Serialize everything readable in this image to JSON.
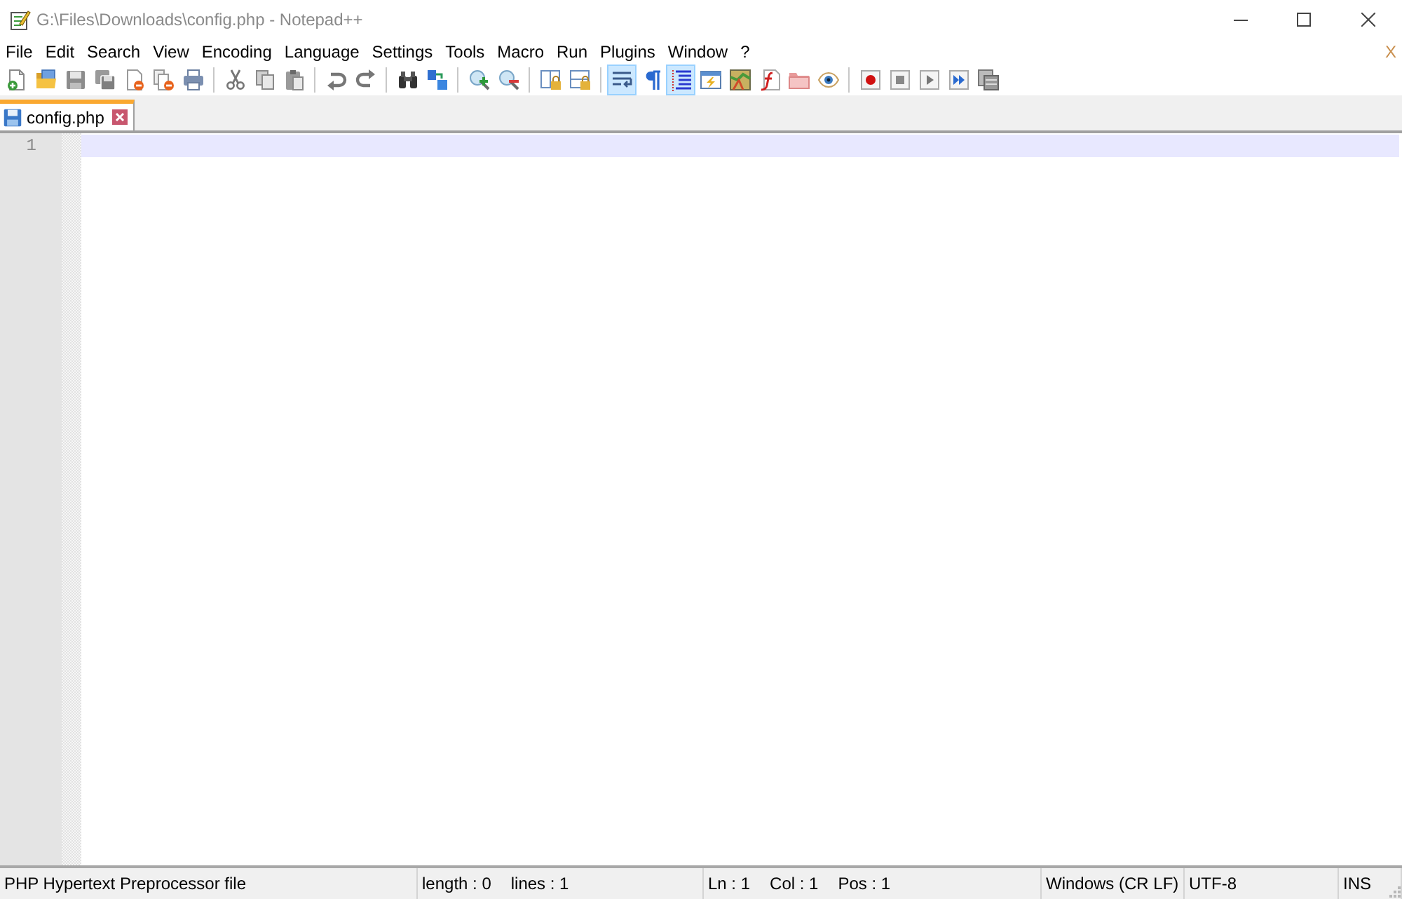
{
  "window": {
    "title": "G:\\Files\\Downloads\\config.php - Notepad++"
  },
  "menu": {
    "items": [
      "File",
      "Edit",
      "Search",
      "View",
      "Encoding",
      "Language",
      "Settings",
      "Tools",
      "Macro",
      "Run",
      "Plugins",
      "Window",
      "?"
    ],
    "close": "X"
  },
  "toolbar": {
    "groups": [
      [
        {
          "kind": "new",
          "pressed": false
        },
        {
          "kind": "open",
          "pressed": false
        },
        {
          "kind": "save",
          "pressed": false
        },
        {
          "kind": "saveall",
          "pressed": false
        },
        {
          "kind": "close",
          "pressed": false
        },
        {
          "kind": "closeall",
          "pressed": false
        },
        {
          "kind": "print",
          "pressed": false
        }
      ],
      [
        {
          "kind": "cut",
          "pressed": false
        },
        {
          "kind": "copy",
          "pressed": false
        },
        {
          "kind": "paste",
          "pressed": false
        }
      ],
      [
        {
          "kind": "undo",
          "pressed": false
        },
        {
          "kind": "redo",
          "pressed": false
        }
      ],
      [
        {
          "kind": "find",
          "pressed": false
        },
        {
          "kind": "replace",
          "pressed": false
        }
      ],
      [
        {
          "kind": "zoomin",
          "pressed": false
        },
        {
          "kind": "zoomout",
          "pressed": false
        }
      ],
      [
        {
          "kind": "syncv",
          "pressed": false
        },
        {
          "kind": "synch",
          "pressed": false
        }
      ],
      [
        {
          "kind": "wrap",
          "pressed": true
        },
        {
          "kind": "allchars",
          "pressed": false
        },
        {
          "kind": "indentguide",
          "pressed": true
        },
        {
          "kind": "udl",
          "pressed": false
        },
        {
          "kind": "docmap",
          "pressed": false
        },
        {
          "kind": "funclist",
          "pressed": false
        },
        {
          "kind": "workspace",
          "pressed": false
        },
        {
          "kind": "monitor",
          "pressed": false
        }
      ],
      [
        {
          "kind": "record",
          "pressed": false
        },
        {
          "kind": "stop",
          "pressed": false
        },
        {
          "kind": "play",
          "pressed": false
        },
        {
          "kind": "playmulti",
          "pressed": false
        },
        {
          "kind": "savemacro",
          "pressed": false
        }
      ]
    ]
  },
  "tabs": [
    {
      "label": "config.php",
      "selected": true
    }
  ],
  "editor": {
    "lines": [
      {
        "number": "1",
        "current": true
      }
    ]
  },
  "status_bar": {
    "panels": [
      {
        "texts": [
          "PHP Hypertext Preprocessor file"
        ]
      },
      {
        "texts": [
          "length : 0",
          "lines : 1"
        ]
      },
      {
        "texts": [
          "Ln : 1",
          "Col : 1",
          "Pos : 1"
        ]
      },
      {
        "texts": [
          "Windows (CR LF)"
        ]
      },
      {
        "texts": [
          "UTF-8"
        ]
      },
      {
        "texts": [
          "INS"
        ]
      }
    ]
  }
}
